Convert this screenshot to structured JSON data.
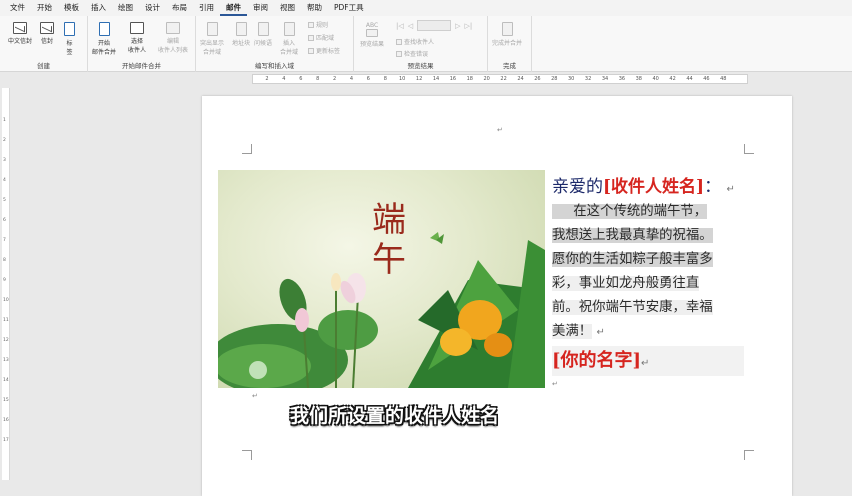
{
  "menubar": {
    "items": [
      "文件",
      "开始",
      "模板",
      "插入",
      "绘图",
      "设计",
      "布局",
      "引用",
      "邮件",
      "审阅",
      "视图",
      "帮助",
      "PDF工具"
    ],
    "active_index": 8
  },
  "ribbon": {
    "create": {
      "label": "创建",
      "chinese_envelope": "中文信封",
      "envelope": "信封",
      "labels_l1": "标",
      "labels_l2": "签"
    },
    "start_merge": {
      "label": "开始邮件合并",
      "start_l1": "开始",
      "start_l2": "邮件合并",
      "select_l1": "选择",
      "select_l2": "收件人",
      "edit_l1": "编辑",
      "edit_l2": "收件人列表"
    },
    "write_insert": {
      "label": "编写和插入域",
      "highlight_l1": "突出显示",
      "highlight_l2": "合并域",
      "address_block": "地址块",
      "greeting_line": "问候语",
      "insert_l1": "插入",
      "insert_l2": "合并域",
      "rules": "规则",
      "match_fields": "匹配域",
      "update_labels": "更新标签"
    },
    "preview": {
      "label": "预览结果",
      "icon_text": "ABC",
      "preview_results": "预览结果",
      "find_recipient": "查找收件人",
      "check_errors": "检查错误"
    },
    "finish": {
      "label": "完成",
      "finish_merge": "完成并合并"
    }
  },
  "ruler": {
    "numbers": [
      "2",
      "4",
      "6",
      "8",
      "2",
      "4",
      "6",
      "8",
      "10",
      "12",
      "14",
      "16",
      "18",
      "20",
      "22",
      "24",
      "26",
      "28",
      "30",
      "32",
      "34",
      "36",
      "38",
      "40",
      "42",
      "44",
      "46",
      "48"
    ]
  },
  "vruler": {
    "numbers": [
      "1",
      "2",
      "3",
      "4",
      "5",
      "6",
      "7",
      "8",
      "9",
      "10",
      "11",
      "12",
      "13",
      "14",
      "15",
      "16",
      "17"
    ]
  },
  "letter": {
    "greeting_prefix": "亲爱的",
    "merge_field": "[收件人姓名]",
    "greeting_suffix": "：",
    "lines": [
      "在这个传统的端午节，",
      "我想送上我最真挚的祝福。",
      "愿你的生活如粽子般丰富多",
      "彩，事业如龙舟般勇往直",
      "前。祝你端午节安康，幸福",
      "美满！"
    ],
    "signature": "[你的名字]",
    "return_mark": "↵"
  },
  "photo": {
    "title_l1": "端",
    "title_l2": "午"
  },
  "subtitle": "我们所设置的收件人姓名"
}
